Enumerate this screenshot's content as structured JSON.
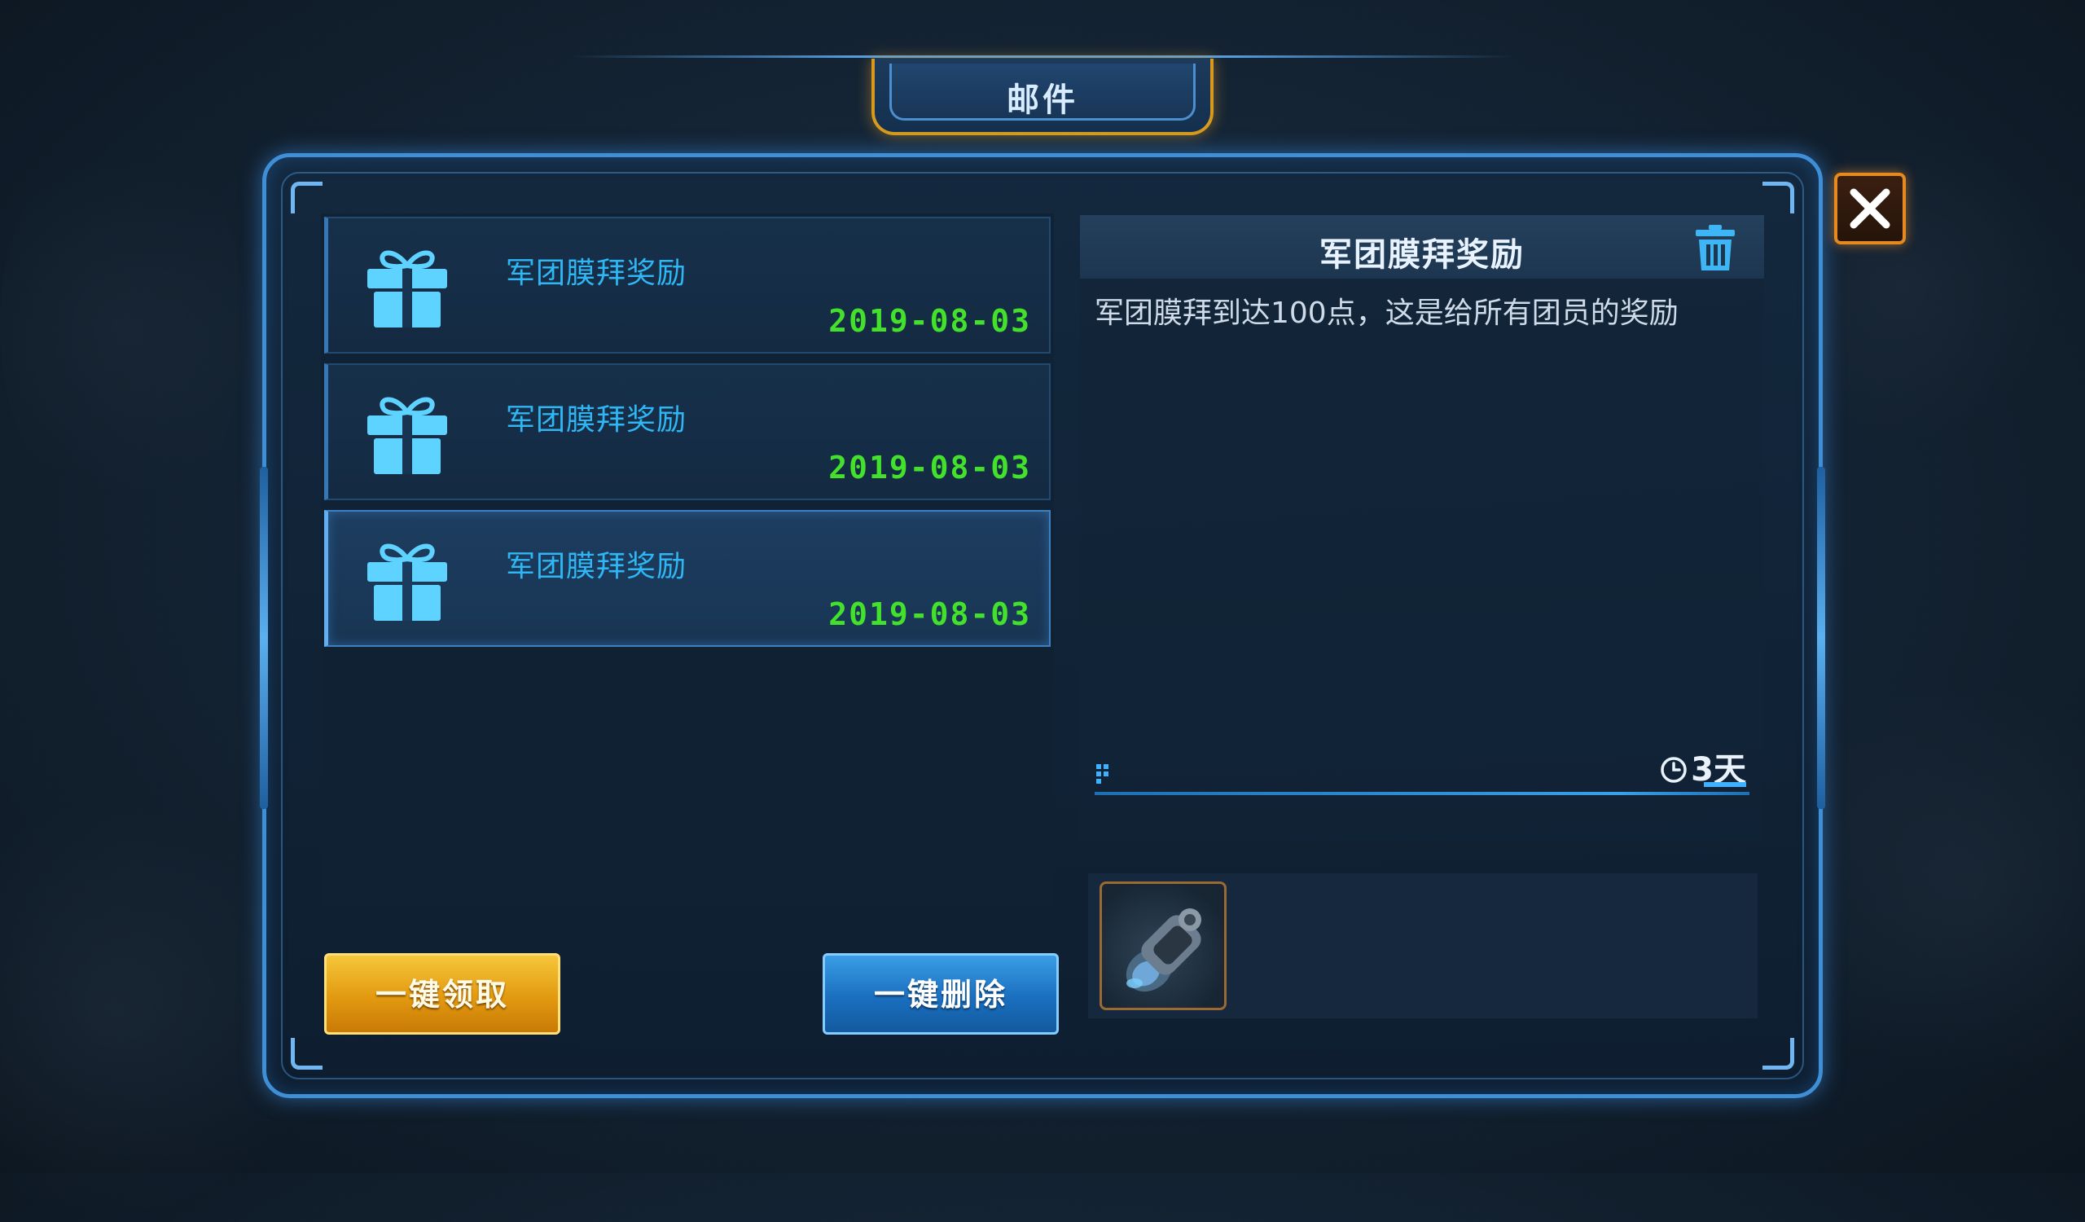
{
  "window": {
    "title": "邮件"
  },
  "mail_list": [
    {
      "title": "军团膜拜奖励",
      "date": "2019-08-03",
      "icon": "gift-icon",
      "selected": false
    },
    {
      "title": "军团膜拜奖励",
      "date": "2019-08-03",
      "icon": "gift-icon",
      "selected": false
    },
    {
      "title": "军团膜拜奖励",
      "date": "2019-08-03",
      "icon": "gift-icon",
      "selected": true
    }
  ],
  "buttons": {
    "claim_all": "一键领取",
    "delete_all": "一键删除"
  },
  "detail": {
    "title": "军团膜拜奖励",
    "body": "军团膜拜到达100点，这是给所有团员的奖励",
    "expires": "3天",
    "attachment_icon": "item-canister-icon"
  },
  "colors": {
    "accent_blue": "#3f8fd6",
    "date_green": "#43e02c",
    "title_cyan": "#2fb6f4",
    "claim_gold": "#e29a10",
    "close_orange": "#e58a1e"
  }
}
